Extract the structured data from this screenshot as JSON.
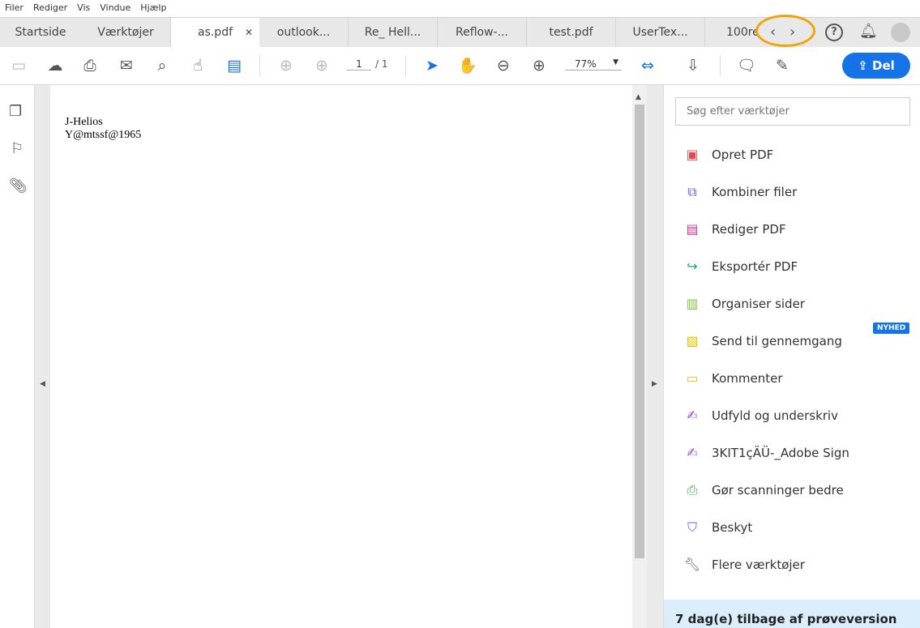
{
  "menu": [
    "Filer",
    "Rediger",
    "Vis",
    "Vindue",
    "Hjælp"
  ],
  "tabs": [
    {
      "label": "Startside"
    },
    {
      "label": "Værktøjer"
    },
    {
      "label": "as.pdf",
      "active": true
    },
    {
      "label": "outlook..."
    },
    {
      "label": "Re_ Hell..."
    },
    {
      "label": "Reflow-..."
    },
    {
      "label": "test.pdf"
    },
    {
      "label": "UserTex..."
    },
    {
      "label": "100re"
    }
  ],
  "toolbar": {
    "page_current": "1",
    "page_total": "/ 1",
    "zoom": "77%",
    "share_label": "Del"
  },
  "document": {
    "lines": [
      "J-Helios",
      "Y@mtssf@1965"
    ]
  },
  "tools_panel": {
    "search_placeholder": "Søg efter værktøjer",
    "items": [
      {
        "label": "Opret PDF",
        "color": "#e34850"
      },
      {
        "label": "Kombiner filer",
        "color": "#6b5ce7"
      },
      {
        "label": "Rediger PDF",
        "color": "#d83790"
      },
      {
        "label": "Eksportér PDF",
        "color": "#26998f"
      },
      {
        "label": "Organiser sider",
        "color": "#7fc341"
      },
      {
        "label": "Send til gennemgang",
        "color": "#e6c200",
        "badge": "NYHED"
      },
      {
        "label": "Kommenter",
        "color": "#f0c020"
      },
      {
        "label": "Udfyld og underskriv",
        "color": "#8d4fc9"
      },
      {
        "label": "3KIT1çÄÜ-_Adobe Sign",
        "color": "#8d4fc9"
      },
      {
        "label": "Gør scanninger bedre",
        "color": "#3da74e"
      },
      {
        "label": "Beskyt",
        "color": "#5d6ee0"
      },
      {
        "label": "Flere værktøjer",
        "color": "#555555"
      }
    ],
    "trial": "7 dag(e) tilbage af prøveversion"
  },
  "colors": {
    "accent": "#1473e6",
    "highlight_ring": "#f0a30a"
  }
}
